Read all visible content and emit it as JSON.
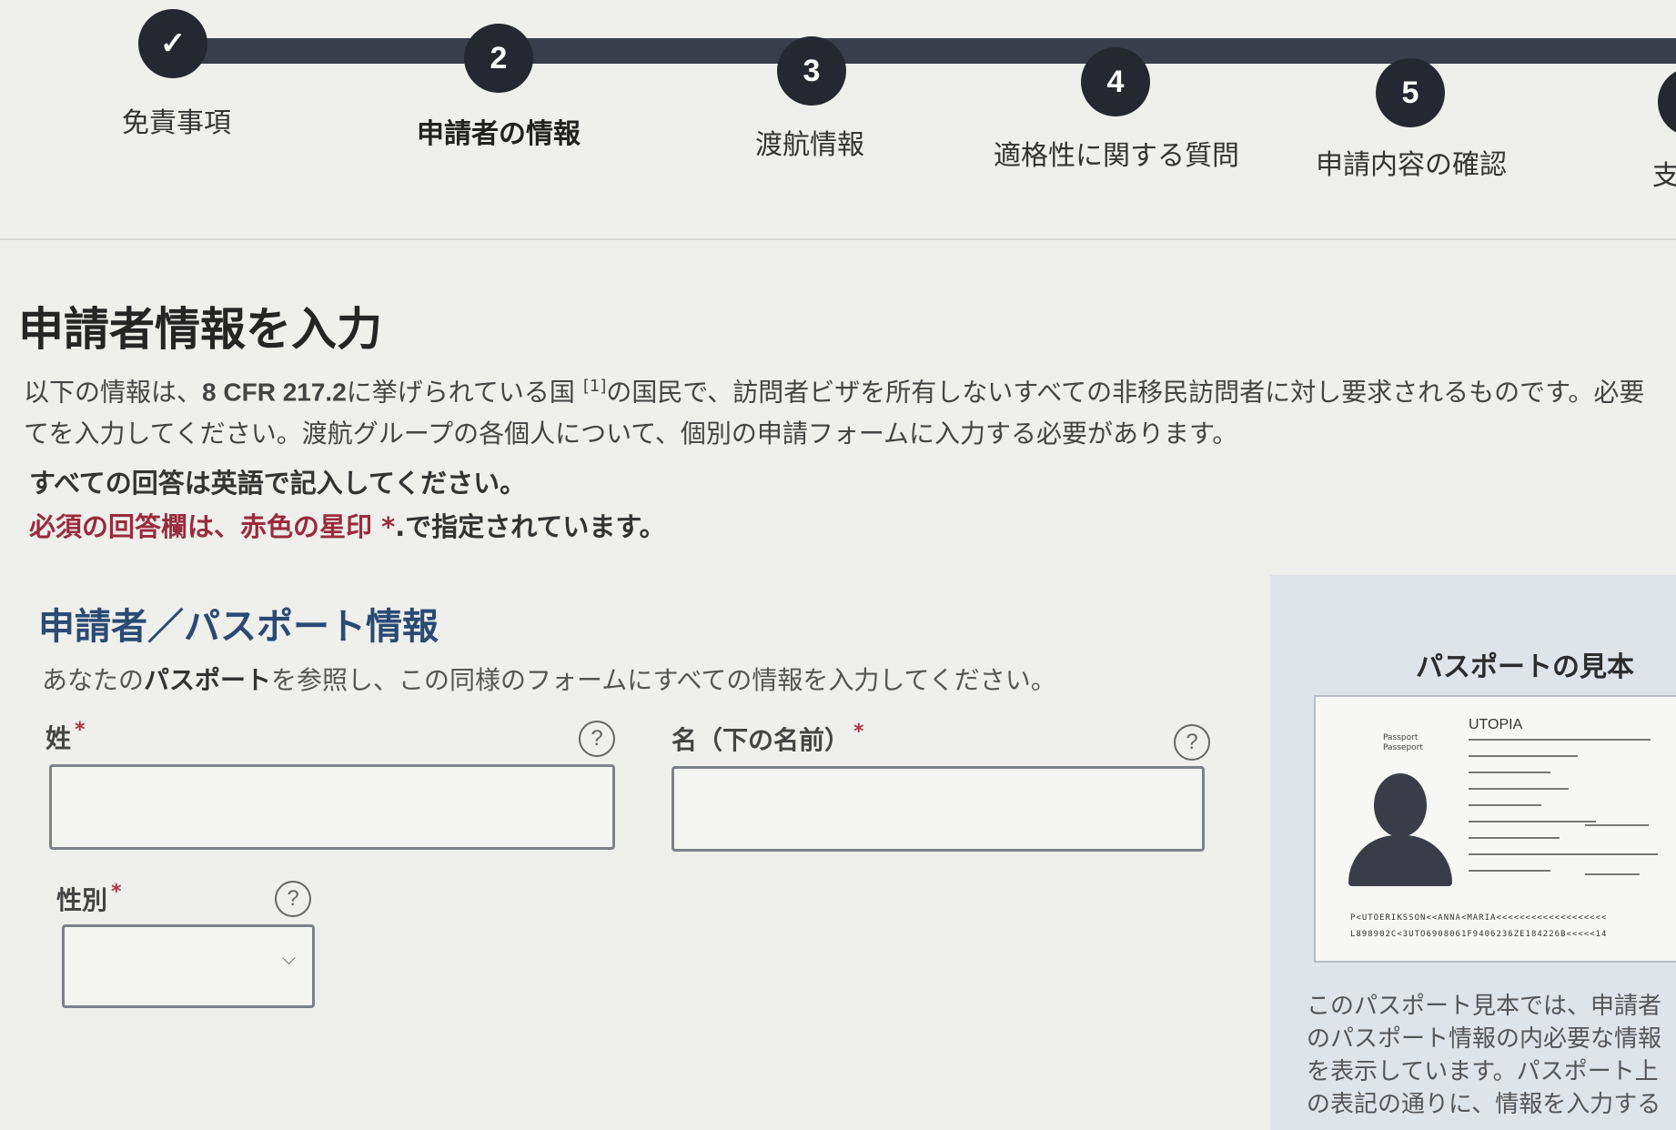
{
  "stepper": {
    "steps": [
      {
        "number": "✓",
        "label": "免責事項",
        "state": "done"
      },
      {
        "number": "2",
        "label": "申請者の情報",
        "state": "active"
      },
      {
        "number": "3",
        "label": "渡航情報",
        "state": "pending"
      },
      {
        "number": "4",
        "label": "適格性に関する質問",
        "state": "pending"
      },
      {
        "number": "5",
        "label": "申請内容の確認",
        "state": "pending"
      },
      {
        "number": "",
        "label": "支",
        "state": "pending"
      }
    ]
  },
  "page_title": "申請者情報を入力",
  "intro": {
    "pre": "以下の情報は、",
    "cfr": "8 CFR 217.2",
    "mid": "に挙げられている国",
    "footnote": "[1]",
    "post": "の国民で、訪問者ビザを所有しないすべての非移民訪問者に対し要求されるものです。必要",
    "line2": "てを入力してください。渡航グループの各個人について、個別の申請フォームに入力する必要があります。"
  },
  "notes": {
    "english": "すべての回答は英語で記入してください。",
    "required_red": "必須の回答欄は、赤色の星印",
    "required_star": " *",
    "required_rest": ".で指定されています。"
  },
  "section": {
    "title": "申請者／パスポート情報",
    "subtitle_pre": "あなたの",
    "subtitle_bold": "パスポート",
    "subtitle_post": "を参照し、この同様のフォームにすべての情報を入力してください。"
  },
  "fields": {
    "surname": {
      "label": "姓",
      "required": "*",
      "value": ""
    },
    "given_name": {
      "label": "名（下の名前）",
      "required": "*",
      "value": ""
    },
    "gender": {
      "label": "性別",
      "required": "*",
      "value": ""
    }
  },
  "help_glyph": "?",
  "passport_sample": {
    "title": "パスポートの見本",
    "country": "UTOPIA",
    "doc_label": "Passport\nPasseport",
    "mrz1": "P<UTOERIKSSON<<ANNA<MARIA<<<<<<<<<<<<<<<<<<<",
    "mrz2": "L898902C<3UTO6908061F9406236ZE184226B<<<<<14",
    "description": "このパスポート見本では、申請者のパスポート情報の内必要な情報を表示しています。パスポート上の表記の通りに、情報を入力する"
  },
  "colors": {
    "stepper_dark": "#252830",
    "section_title": "#2b4a74",
    "required_red": "#9a2b3c",
    "panel_bg": "#dfe3ea"
  }
}
